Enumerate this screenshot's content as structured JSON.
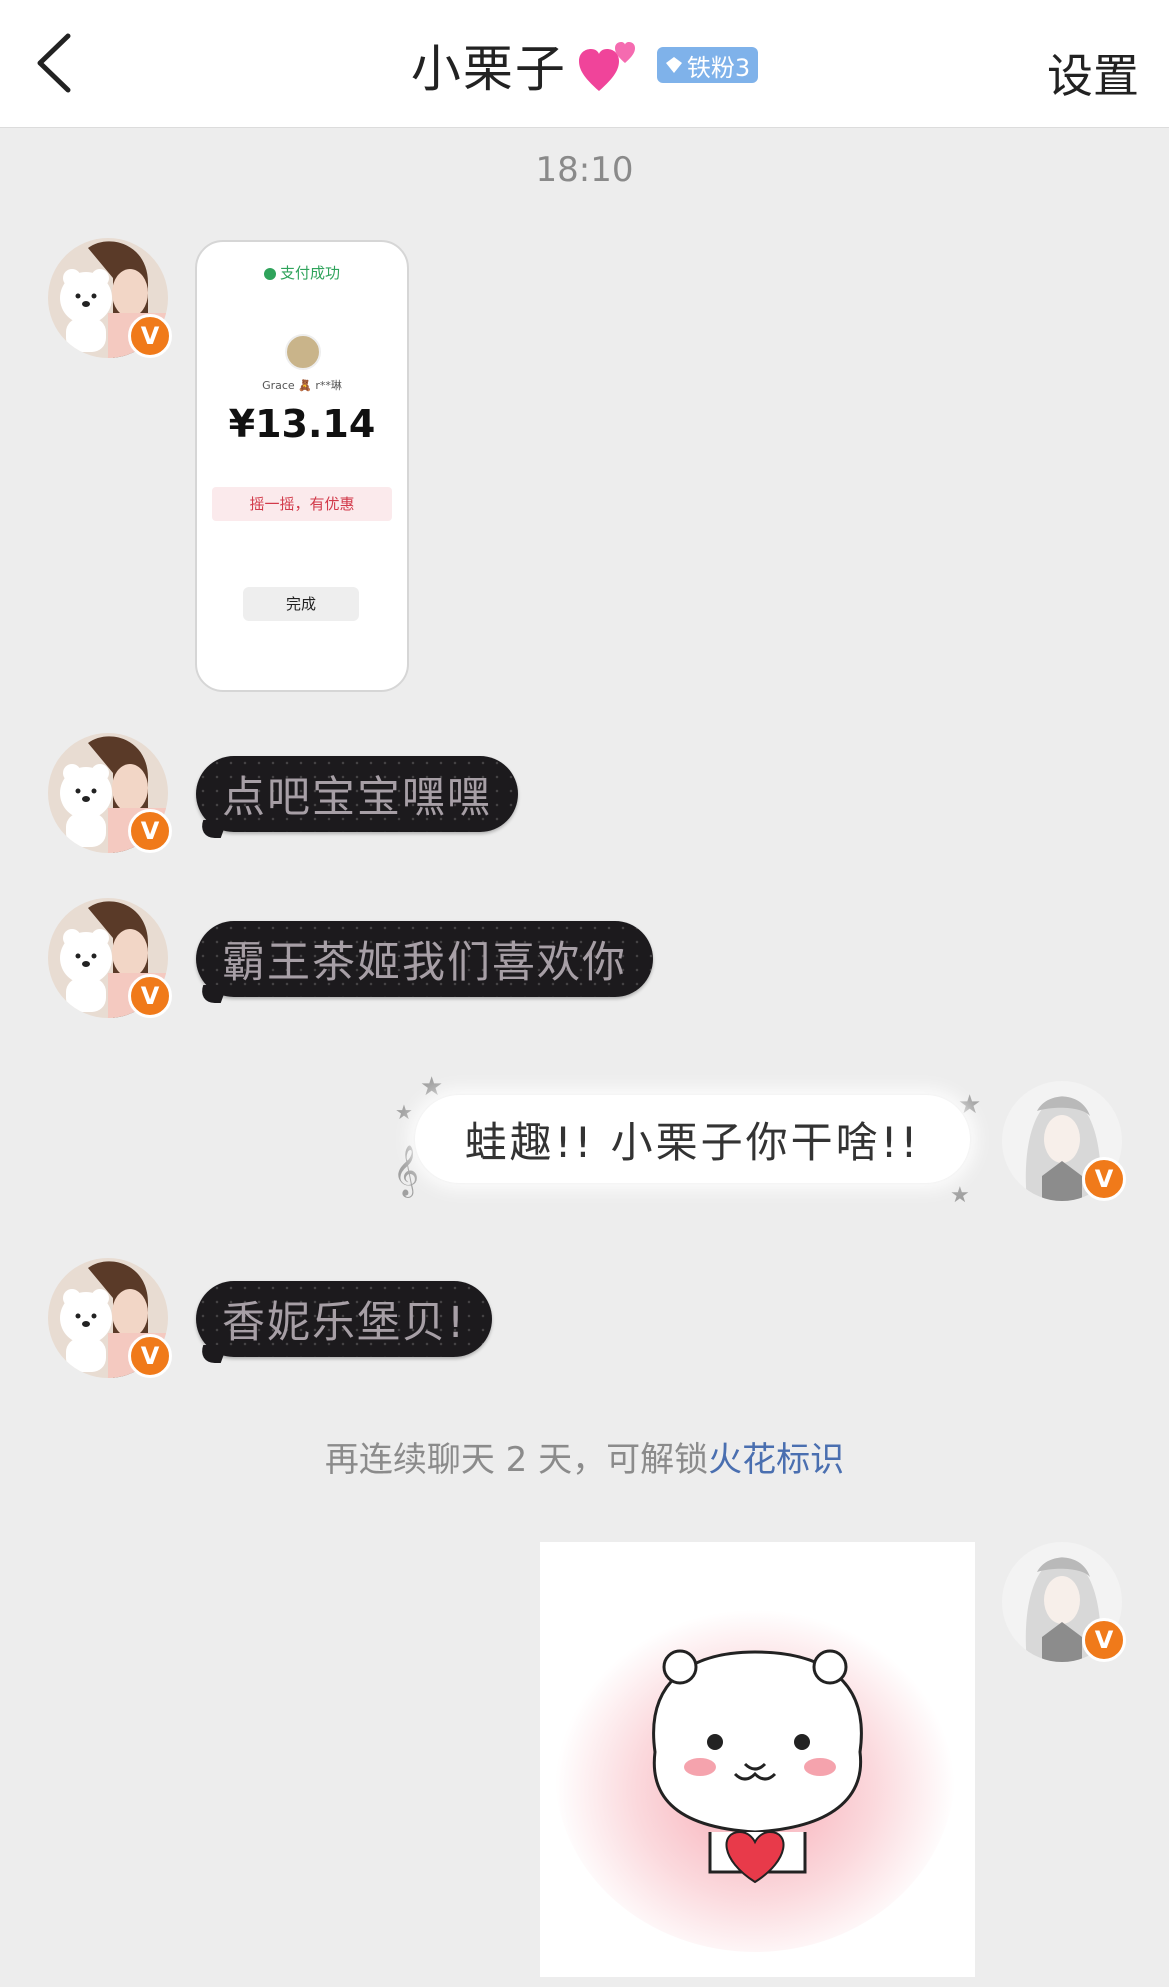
{
  "header": {
    "title": "小栗子",
    "badge_text": "铁粉3",
    "settings_label": "设置"
  },
  "timestamp": "18:10",
  "messages": {
    "payment_card": {
      "status": "支付成功",
      "payee": "Grace 🧸  r**琳",
      "amount": "¥13.14",
      "promo": "摇一摇，有优惠",
      "done_label": "完成"
    },
    "msg1": "点吧宝宝嘿嘿",
    "msg2": "霸王茶姬我们喜欢你",
    "msg3": "蛙趣!! 小栗子你干啥!!",
    "msg4": "香妮乐堡贝!"
  },
  "system_tip": {
    "text": "再连续聊天 2 天，可解锁",
    "link": "火花标识"
  },
  "colors": {
    "badge_bg": "#7fb2ea",
    "verify_badge": "#f07a1a",
    "dark_bubble": "#1c1a1d",
    "link": "#4a6fb0"
  },
  "icons": {
    "back": "chevron-left-icon",
    "heart": "two-hearts-icon",
    "verified": "v-verified-icon",
    "diamond": "diamond-icon"
  },
  "verify_glyph": "V"
}
